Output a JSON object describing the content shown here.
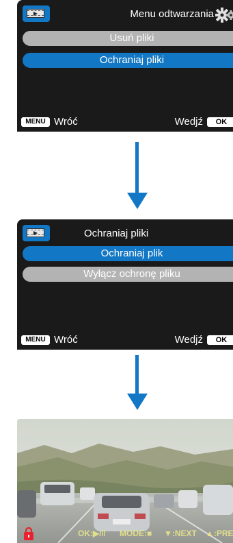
{
  "screen1": {
    "title": "Menu odtwarzania",
    "items": [
      {
        "label": "Usuń pliki",
        "selected": false
      },
      {
        "label": "Ochraniaj pliki",
        "selected": true
      }
    ],
    "footer": {
      "menu_key": "MENU",
      "back": "Wróć",
      "enter": "Wedjź",
      "ok_key": "OK"
    }
  },
  "screen2": {
    "title": "Ochraniaj pliki",
    "items": [
      {
        "label": "Ochraniaj plik",
        "selected": true
      },
      {
        "label": "Wyłącz ochronę pliku",
        "selected": false
      }
    ],
    "footer": {
      "menu_key": "MENU",
      "back": "Wróć",
      "enter": "Wedjź",
      "ok_key": "OK"
    }
  },
  "video": {
    "osd": {
      "ok": "OK:▶/‖",
      "mode": "MODE:■",
      "next": "▼:NEXT",
      "prev": "▲:PRE"
    },
    "locked": true
  },
  "colors": {
    "accent": "#1277c4",
    "item_gray": "#b3b3b3",
    "screen_bg": "#1a1a1a",
    "osd": "#e9e78a",
    "lock": "#e8232f"
  }
}
